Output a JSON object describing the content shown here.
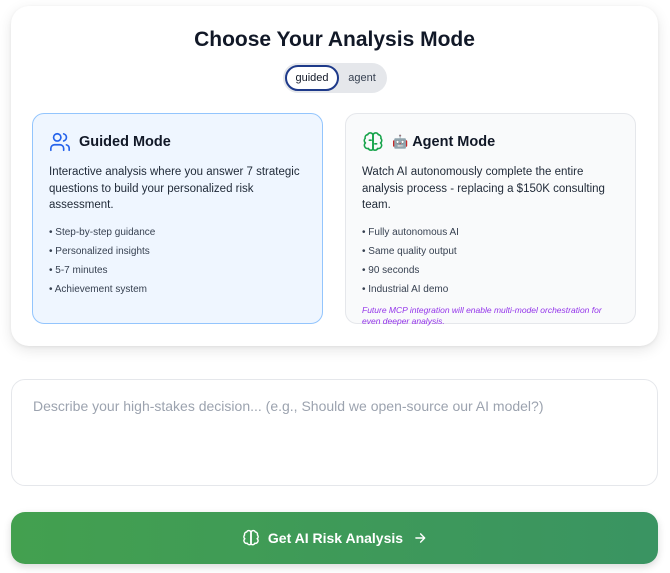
{
  "mode_selector": {
    "title": "Choose Your Analysis Mode",
    "toggle": {
      "options": [
        "guided",
        "agent"
      ],
      "selected": "guided"
    }
  },
  "guided_mode": {
    "icon": "users-icon",
    "title": "Guided Mode",
    "description": "Interactive analysis where you answer 7 strategic questions to build your personalized risk assessment.",
    "features": [
      "Step-by-step guidance",
      "Personalized insights",
      "5-7 minutes",
      "Achievement system"
    ],
    "accent": "#2563eb"
  },
  "agent_mode": {
    "icon": "brain-icon",
    "emoji": "🤖",
    "title": "Agent Mode",
    "description": "Watch AI autonomously complete the entire analysis process - replacing a $150K consulting team.",
    "features": [
      "Fully autonomous AI",
      "Same quality output",
      "90 seconds",
      "Industrial AI demo"
    ],
    "note": "Future MCP integration will enable multi-model orchestration for even deeper analysis.",
    "accent": "#16a34a"
  },
  "decision_input": {
    "value": "",
    "placeholder": "Describe your high-stakes decision... (e.g., Should we open-source our AI model?)"
  },
  "submit": {
    "label": "Get AI Risk Analysis",
    "icon": "brain-icon",
    "trailing_icon": "arrow-right-icon",
    "color_start": "#43a04f",
    "color_end": "#3a9462"
  }
}
